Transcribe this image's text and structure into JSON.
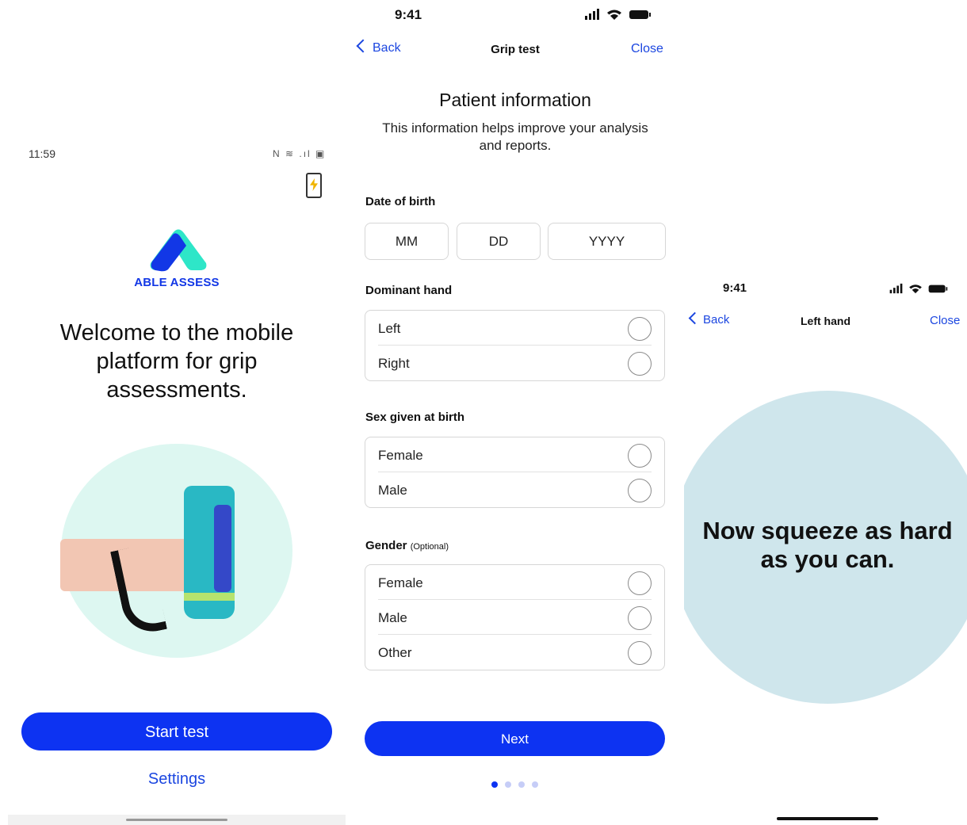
{
  "screen1": {
    "time": "11:59",
    "status_icons": "N ≋ .ıl ▣",
    "brand": "ABLE ASSESS",
    "welcome": "Welcome to the mobile platform for grip assessments.",
    "start_button": "Start test",
    "settings_link": "Settings",
    "colors": {
      "primary": "#0d33f2",
      "logo_teal": "#2ee6c8",
      "logo_blue": "#1237e6",
      "hero_bg": "#ddf7f1"
    }
  },
  "screen2": {
    "time": "9:41",
    "nav": {
      "back": "Back",
      "title": "Grip test",
      "close": "Close"
    },
    "heading": "Patient information",
    "subheading": "This information helps improve your analysis and reports.",
    "dob": {
      "label": "Date of birth",
      "month_placeholder": "MM",
      "day_placeholder": "DD",
      "year_placeholder": "YYYY"
    },
    "dominant_hand": {
      "label": "Dominant hand",
      "options": [
        "Left",
        "Right"
      ]
    },
    "sex": {
      "label": "Sex given at birth",
      "options": [
        "Female",
        "Male"
      ]
    },
    "gender": {
      "label": "Gender",
      "optional": "(Optional)",
      "options": [
        "Female",
        "Male",
        "Other"
      ]
    },
    "next_button": "Next",
    "pager": {
      "total": 4,
      "current": 1
    }
  },
  "screen3": {
    "time": "9:41",
    "nav": {
      "back": "Back",
      "title": "Left hand",
      "close": "Close"
    },
    "prompt": "Now squeeze as hard as you can.",
    "colors": {
      "halo": "#cfe6ec"
    }
  }
}
